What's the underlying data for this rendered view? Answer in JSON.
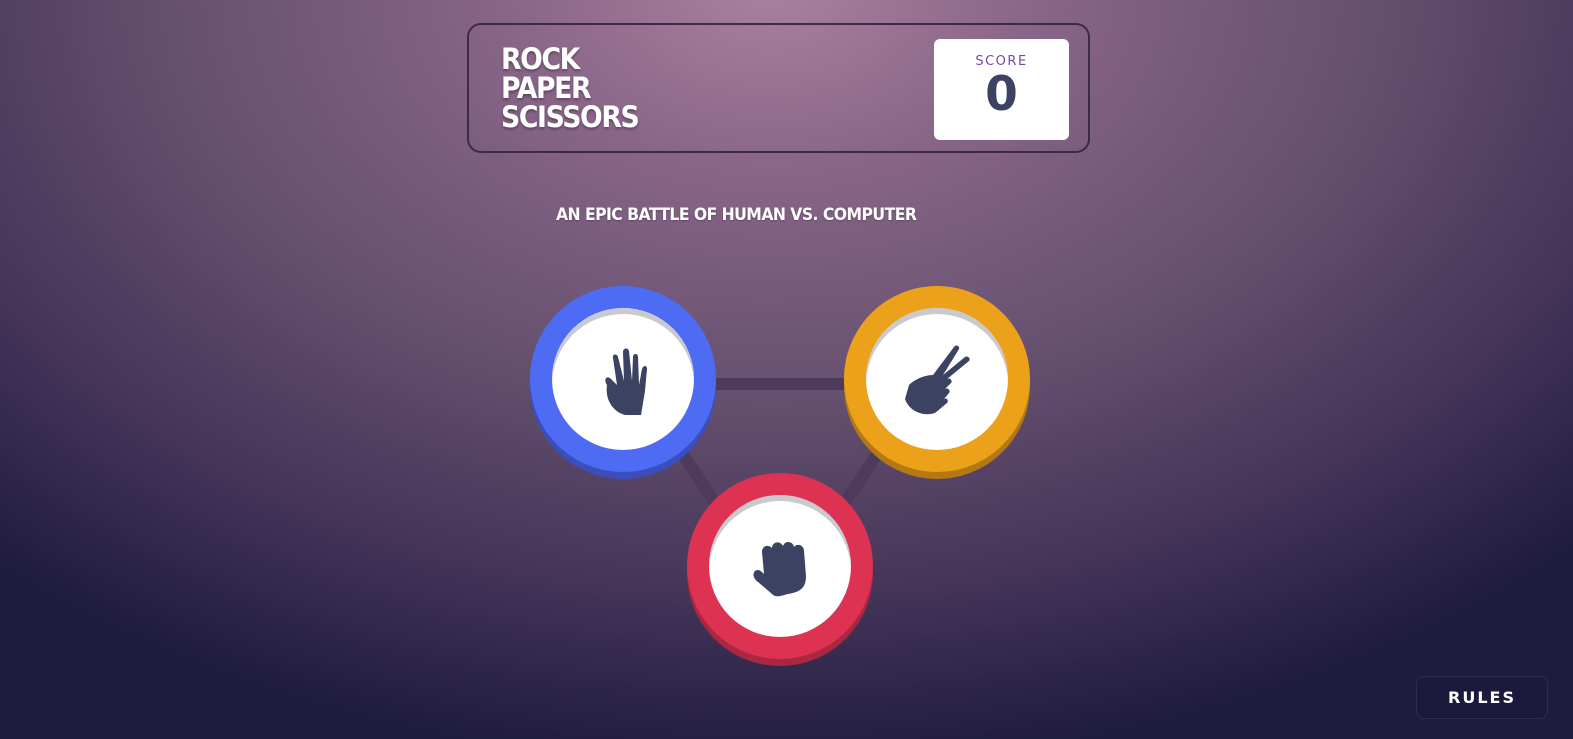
{
  "header": {
    "title_lines": [
      "ROCK",
      "PAPER",
      "SCISSORS"
    ],
    "score_label": "SCORE",
    "score_value": "0"
  },
  "tagline": "AN EPIC BATTLE OF HUMAN VS. COMPUTER",
  "choices": [
    {
      "name": "paper",
      "icon": "paper-hand-icon",
      "color": "#4e6bf4"
    },
    {
      "name": "scissors",
      "icon": "scissors-hand-icon",
      "color": "#eba21a"
    },
    {
      "name": "rock",
      "icon": "rock-fist-icon",
      "color": "#dd3251"
    }
  ],
  "rules_button": "RULES",
  "colors": {
    "icon": "#3b4262",
    "score_label": "#7a45b0",
    "connector": "#4e3b5c"
  }
}
